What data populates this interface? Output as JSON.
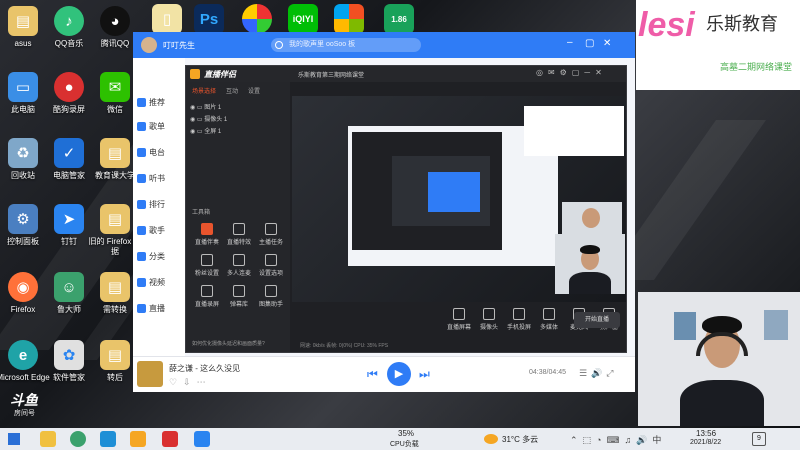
{
  "desktop": {
    "icons": [
      {
        "label": "asus"
      },
      {
        "label": "QQ音乐"
      },
      {
        "label": "腾讯QQ"
      },
      {
        "label": "此电脑"
      },
      {
        "label": "酷狗录屏"
      },
      {
        "label": "微信"
      },
      {
        "label": "回收站"
      },
      {
        "label": "电脑管家"
      },
      {
        "label": "教育课大学"
      },
      {
        "label": "控制面板"
      },
      {
        "label": "钉钉"
      },
      {
        "label": "旧的 Firefox 数据"
      },
      {
        "label": "Firefox"
      },
      {
        "label": "鲁大师"
      },
      {
        "label": "需转换"
      },
      {
        "label": "Microsoft Edge"
      },
      {
        "label": "软件管家"
      },
      {
        "label": "转后"
      }
    ],
    "top_apps": [
      {
        "label": "Ps"
      },
      {
        "label": "iQIYI"
      },
      {
        "label": "1.86"
      }
    ],
    "watermark": "斗鱼",
    "watermark_sub": "房间号"
  },
  "music_app": {
    "title": "叮叮先生",
    "search_placeholder": "我的歌声里 ooSoo 板",
    "sidebar": [
      {
        "label": "推荐"
      },
      {
        "label": "歌单"
      },
      {
        "label": "电台"
      },
      {
        "label": "听书"
      },
      {
        "label": "排行"
      },
      {
        "label": "歌手"
      },
      {
        "label": "分类"
      },
      {
        "label": "视频"
      },
      {
        "label": "直播"
      }
    ],
    "player": {
      "song": "薛之谦 - 这么久没见",
      "time": "04:38/04:45"
    }
  },
  "stream_app": {
    "title": "直播伴侣",
    "tabs": [
      {
        "label": "场景选择"
      },
      {
        "label": "互动"
      },
      {
        "label": "设置"
      }
    ],
    "broadcast_title": "乐斯教育第三期网络课堂",
    "scenes": [
      {
        "label": "图片 1"
      },
      {
        "label": "摄像头 1"
      },
      {
        "label": "全屏 1"
      }
    ],
    "workbench_label": "工具箱",
    "tools": [
      {
        "label": "直播伴奏"
      },
      {
        "label": "直播特效"
      },
      {
        "label": "主播任务"
      },
      {
        "label": "粉丝设置"
      },
      {
        "label": "多人连麦"
      },
      {
        "label": "设置选项"
      },
      {
        "label": "直播录屏"
      },
      {
        "label": "弹幕库"
      },
      {
        "label": "图集助手"
      }
    ],
    "bottom_tools": [
      {
        "label": "直播屏幕"
      },
      {
        "label": "摄像头"
      },
      {
        "label": "手机投屏"
      },
      {
        "label": "多媒体"
      },
      {
        "label": "麦克风"
      },
      {
        "label": "扬声器"
      }
    ],
    "start_label": "开始直播",
    "status_note": "如何优化摄像头延迟和画面质量?",
    "stats": "网速: 0kb/s   丢帧: 0(0%)   CPU: 35%   FPS"
  },
  "banner": {
    "brand": "乐斯教育",
    "logo_text": "lesi",
    "tagline": "高墓二期网络课堂"
  },
  "taskbar": {
    "cpu_value": "35%",
    "cpu_label": "CPU负载",
    "weather": "31°C 多云",
    "time": "13:56",
    "date": "2021/8/22",
    "notif_count": "9"
  }
}
